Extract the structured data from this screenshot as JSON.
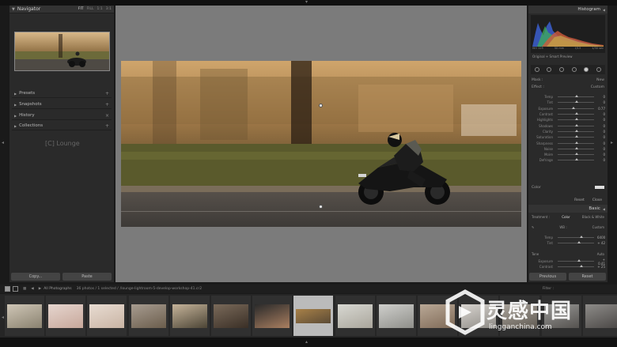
{
  "left_panel": {
    "navigator": {
      "title": "Navigator",
      "zoom_options": [
        "FIT",
        "FILL",
        "1:1",
        "3:1"
      ]
    },
    "panels": [
      "Presets",
      "Snapshots",
      "History",
      "Collections"
    ],
    "brand": "[C] Lounge",
    "copy_label": "Copy...",
    "paste_label": "Paste"
  },
  "right_panel": {
    "histogram_title": "Histogram",
    "histogram_info": [
      "ISO 125",
      "50 mm",
      "f/13",
      "1/30 sec"
    ],
    "preview_label": "Original + Smart Preview",
    "mask_label": "Mask :",
    "mask_mode": "New",
    "effect_label": "Effect :",
    "effect_value": "Custom",
    "adjustments": [
      {
        "label": "Temp",
        "value": "0"
      },
      {
        "label": "Tint",
        "value": "0"
      },
      {
        "label": "Exposure",
        "value": "0.77"
      },
      {
        "label": "Contrast",
        "value": "0"
      },
      {
        "label": "Highlights",
        "value": "0"
      },
      {
        "label": "Shadows",
        "value": "0"
      },
      {
        "label": "Clarity",
        "value": "0"
      },
      {
        "label": "Saturation",
        "value": "0"
      },
      {
        "label": "Sharpness",
        "value": "0"
      },
      {
        "label": "Noise",
        "value": "0"
      },
      {
        "label": "Moire",
        "value": "0"
      },
      {
        "label": "Defringe",
        "value": "0"
      }
    ],
    "color_label": "Color",
    "reset_label": "Reset",
    "close_label": "Close",
    "basic_title": "Basic",
    "treatment_label": "Treatment :",
    "treatment_options": [
      "Color",
      "Black & White"
    ],
    "wb_label": "WB :",
    "wb_value": "Custom",
    "basic_sliders": [
      {
        "label": "Temp",
        "value": "6400"
      },
      {
        "label": "Tint",
        "value": "+ 42"
      }
    ],
    "tone_label": "Tone",
    "tone_auto": "Auto",
    "tone_sliders": [
      {
        "label": "Exposure",
        "value": "+ 0.41"
      },
      {
        "label": "Contrast",
        "value": "+ 25"
      }
    ],
    "previous_label": "Previous",
    "reset_button_label": "Reset"
  },
  "filmstrip_bar": {
    "source": "All Photographs",
    "count": "36 photos / 1 selected /",
    "filename": "/lounge-lightroom-5-develop-workshop-41.cr2",
    "filter_label": "Filter :",
    "filter_value": "Filters Off"
  },
  "watermark": {
    "cn": "灵感中国",
    "en": "lingganchina.com"
  }
}
